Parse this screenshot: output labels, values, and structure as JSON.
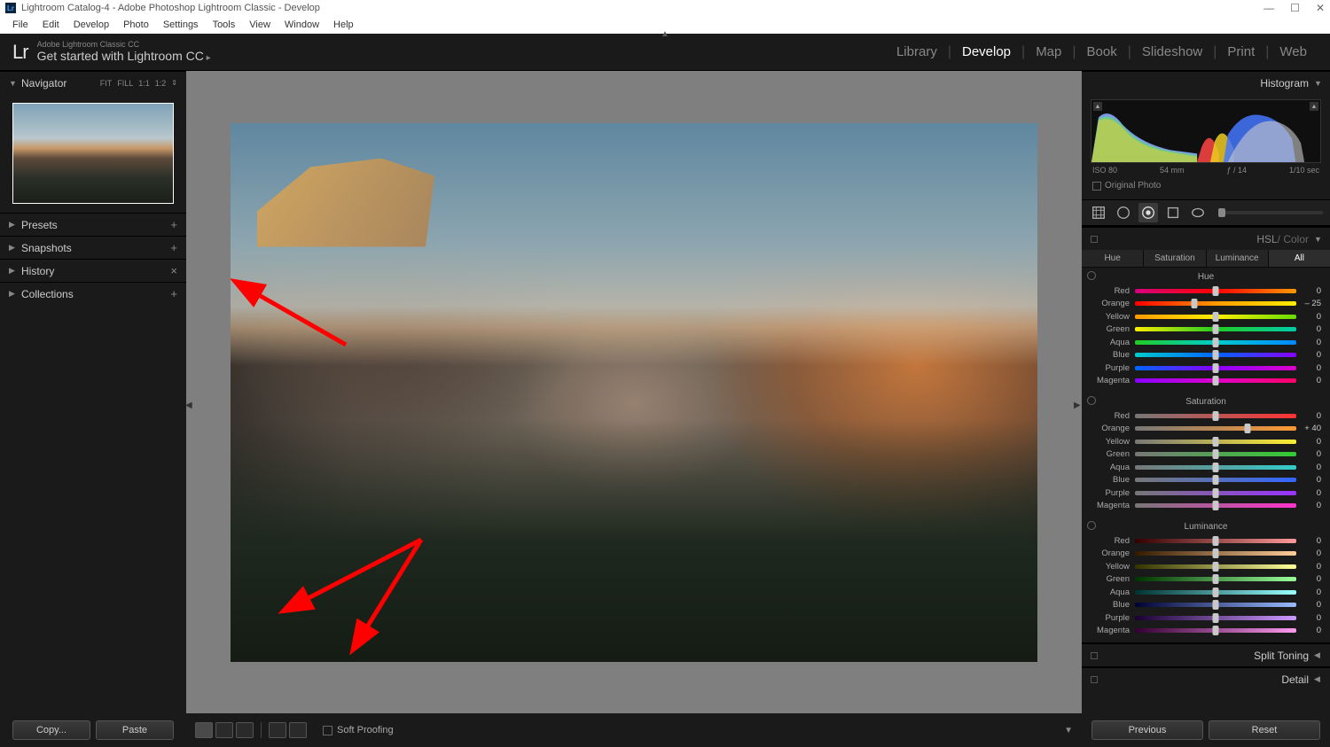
{
  "window": {
    "title": "Lightroom Catalog-4 - Adobe Photoshop Lightroom Classic - Develop",
    "app_badge": "Lr"
  },
  "menubar": [
    "File",
    "Edit",
    "Develop",
    "Photo",
    "Settings",
    "Tools",
    "View",
    "Window",
    "Help"
  ],
  "header": {
    "logo": "Lr",
    "small": "Adobe Lightroom Classic CC",
    "large": "Get started with Lightroom CC"
  },
  "modules": [
    "Library",
    "Develop",
    "Map",
    "Book",
    "Slideshow",
    "Print",
    "Web"
  ],
  "active_module": "Develop",
  "navigator": {
    "title": "Navigator",
    "zooms": [
      "FIT",
      "FILL",
      "1:1",
      "1:2"
    ]
  },
  "left_panels": [
    {
      "title": "Presets",
      "action": "+"
    },
    {
      "title": "Snapshots",
      "action": "+"
    },
    {
      "title": "History",
      "action": "×"
    },
    {
      "title": "Collections",
      "action": "+"
    }
  ],
  "right_panels": {
    "histogram": {
      "title": "Histogram",
      "meta": [
        "ISO 80",
        "54 mm",
        "ƒ / 14",
        "1/10 sec"
      ],
      "original_label": "Original Photo"
    },
    "hsl": {
      "title_main": "HSL",
      "title_sub": " / Color",
      "tabs": [
        "Hue",
        "Saturation",
        "Luminance",
        "All"
      ],
      "active_tab": "All",
      "sections": [
        {
          "name": "Hue",
          "colors": [
            {
              "label": "Red",
              "value": 0,
              "pos": 50,
              "grad": "linear-gradient(90deg,#d4007d,#ff0000,#ff9900)"
            },
            {
              "label": "Orange",
              "value": -25,
              "pos": 37,
              "grad": "linear-gradient(90deg,#ff0000,#ff9900,#ffee00)"
            },
            {
              "label": "Yellow",
              "value": 0,
              "pos": 50,
              "grad": "linear-gradient(90deg,#ff9900,#ffee00,#66dd00)"
            },
            {
              "label": "Green",
              "value": 0,
              "pos": 50,
              "grad": "linear-gradient(90deg,#ffee00,#22cc22,#00ccaa)"
            },
            {
              "label": "Aqua",
              "value": 0,
              "pos": 50,
              "grad": "linear-gradient(90deg,#22cc22,#00cccc,#0088ff)"
            },
            {
              "label": "Blue",
              "value": 0,
              "pos": 50,
              "grad": "linear-gradient(90deg,#00cccc,#0066ff,#8800ff)"
            },
            {
              "label": "Purple",
              "value": 0,
              "pos": 50,
              "grad": "linear-gradient(90deg,#0066ff,#8800ff,#dd00cc)"
            },
            {
              "label": "Magenta",
              "value": 0,
              "pos": 50,
              "grad": "linear-gradient(90deg,#8800ff,#dd00cc,#ff0066)"
            }
          ]
        },
        {
          "name": "Saturation",
          "colors": [
            {
              "label": "Red",
              "value": 0,
              "pos": 50,
              "grad": "linear-gradient(90deg,#777,#ff3333)"
            },
            {
              "label": "Orange",
              "value": "+ 40",
              "pos": 70,
              "grad": "linear-gradient(90deg,#777,#ff9933)"
            },
            {
              "label": "Yellow",
              "value": 0,
              "pos": 50,
              "grad": "linear-gradient(90deg,#777,#ffee33)"
            },
            {
              "label": "Green",
              "value": 0,
              "pos": 50,
              "grad": "linear-gradient(90deg,#777,#33cc33)"
            },
            {
              "label": "Aqua",
              "value": 0,
              "pos": 50,
              "grad": "linear-gradient(90deg,#777,#33cccc)"
            },
            {
              "label": "Blue",
              "value": 0,
              "pos": 50,
              "grad": "linear-gradient(90deg,#777,#3366ff)"
            },
            {
              "label": "Purple",
              "value": 0,
              "pos": 50,
              "grad": "linear-gradient(90deg,#777,#9933ff)"
            },
            {
              "label": "Magenta",
              "value": 0,
              "pos": 50,
              "grad": "linear-gradient(90deg,#777,#ff33cc)"
            }
          ]
        },
        {
          "name": "Luminance",
          "colors": [
            {
              "label": "Red",
              "value": 0,
              "pos": 50,
              "grad": "linear-gradient(90deg,#330000,#ff9999)"
            },
            {
              "label": "Orange",
              "value": 0,
              "pos": 50,
              "grad": "linear-gradient(90deg,#331a00,#ffcc99)"
            },
            {
              "label": "Yellow",
              "value": 0,
              "pos": 50,
              "grad": "linear-gradient(90deg,#333300,#ffff99)"
            },
            {
              "label": "Green",
              "value": 0,
              "pos": 50,
              "grad": "linear-gradient(90deg,#003300,#99ff99)"
            },
            {
              "label": "Aqua",
              "value": 0,
              "pos": 50,
              "grad": "linear-gradient(90deg,#003333,#99ffff)"
            },
            {
              "label": "Blue",
              "value": 0,
              "pos": 50,
              "grad": "linear-gradient(90deg,#000033,#99bbff)"
            },
            {
              "label": "Purple",
              "value": 0,
              "pos": 50,
              "grad": "linear-gradient(90deg,#1a0033,#cc99ff)"
            },
            {
              "label": "Magenta",
              "value": 0,
              "pos": 50,
              "grad": "linear-gradient(90deg,#330033,#ff99ee)"
            }
          ]
        }
      ]
    },
    "split_toning": "Split Toning",
    "detail": "Detail"
  },
  "bottom": {
    "copy": "Copy...",
    "paste": "Paste",
    "soft_proofing": "Soft Proofing",
    "previous": "Previous",
    "reset": "Reset"
  }
}
